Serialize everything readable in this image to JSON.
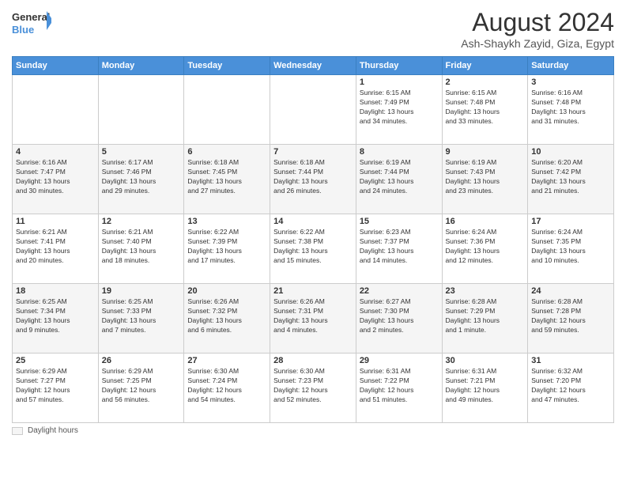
{
  "header": {
    "logo_line1": "General",
    "logo_line2": "Blue",
    "month_title": "August 2024",
    "location": "Ash-Shaykh Zayid, Giza, Egypt"
  },
  "days_of_week": [
    "Sunday",
    "Monday",
    "Tuesday",
    "Wednesday",
    "Thursday",
    "Friday",
    "Saturday"
  ],
  "legend_label": "Daylight hours",
  "weeks": [
    [
      {
        "day": "",
        "info": ""
      },
      {
        "day": "",
        "info": ""
      },
      {
        "day": "",
        "info": ""
      },
      {
        "day": "",
        "info": ""
      },
      {
        "day": "1",
        "info": "Sunrise: 6:15 AM\nSunset: 7:49 PM\nDaylight: 13 hours\nand 34 minutes."
      },
      {
        "day": "2",
        "info": "Sunrise: 6:15 AM\nSunset: 7:48 PM\nDaylight: 13 hours\nand 33 minutes."
      },
      {
        "day": "3",
        "info": "Sunrise: 6:16 AM\nSunset: 7:48 PM\nDaylight: 13 hours\nand 31 minutes."
      }
    ],
    [
      {
        "day": "4",
        "info": "Sunrise: 6:16 AM\nSunset: 7:47 PM\nDaylight: 13 hours\nand 30 minutes."
      },
      {
        "day": "5",
        "info": "Sunrise: 6:17 AM\nSunset: 7:46 PM\nDaylight: 13 hours\nand 29 minutes."
      },
      {
        "day": "6",
        "info": "Sunrise: 6:18 AM\nSunset: 7:45 PM\nDaylight: 13 hours\nand 27 minutes."
      },
      {
        "day": "7",
        "info": "Sunrise: 6:18 AM\nSunset: 7:44 PM\nDaylight: 13 hours\nand 26 minutes."
      },
      {
        "day": "8",
        "info": "Sunrise: 6:19 AM\nSunset: 7:44 PM\nDaylight: 13 hours\nand 24 minutes."
      },
      {
        "day": "9",
        "info": "Sunrise: 6:19 AM\nSunset: 7:43 PM\nDaylight: 13 hours\nand 23 minutes."
      },
      {
        "day": "10",
        "info": "Sunrise: 6:20 AM\nSunset: 7:42 PM\nDaylight: 13 hours\nand 21 minutes."
      }
    ],
    [
      {
        "day": "11",
        "info": "Sunrise: 6:21 AM\nSunset: 7:41 PM\nDaylight: 13 hours\nand 20 minutes."
      },
      {
        "day": "12",
        "info": "Sunrise: 6:21 AM\nSunset: 7:40 PM\nDaylight: 13 hours\nand 18 minutes."
      },
      {
        "day": "13",
        "info": "Sunrise: 6:22 AM\nSunset: 7:39 PM\nDaylight: 13 hours\nand 17 minutes."
      },
      {
        "day": "14",
        "info": "Sunrise: 6:22 AM\nSunset: 7:38 PM\nDaylight: 13 hours\nand 15 minutes."
      },
      {
        "day": "15",
        "info": "Sunrise: 6:23 AM\nSunset: 7:37 PM\nDaylight: 13 hours\nand 14 minutes."
      },
      {
        "day": "16",
        "info": "Sunrise: 6:24 AM\nSunset: 7:36 PM\nDaylight: 13 hours\nand 12 minutes."
      },
      {
        "day": "17",
        "info": "Sunrise: 6:24 AM\nSunset: 7:35 PM\nDaylight: 13 hours\nand 10 minutes."
      }
    ],
    [
      {
        "day": "18",
        "info": "Sunrise: 6:25 AM\nSunset: 7:34 PM\nDaylight: 13 hours\nand 9 minutes."
      },
      {
        "day": "19",
        "info": "Sunrise: 6:25 AM\nSunset: 7:33 PM\nDaylight: 13 hours\nand 7 minutes."
      },
      {
        "day": "20",
        "info": "Sunrise: 6:26 AM\nSunset: 7:32 PM\nDaylight: 13 hours\nand 6 minutes."
      },
      {
        "day": "21",
        "info": "Sunrise: 6:26 AM\nSunset: 7:31 PM\nDaylight: 13 hours\nand 4 minutes."
      },
      {
        "day": "22",
        "info": "Sunrise: 6:27 AM\nSunset: 7:30 PM\nDaylight: 13 hours\nand 2 minutes."
      },
      {
        "day": "23",
        "info": "Sunrise: 6:28 AM\nSunset: 7:29 PM\nDaylight: 13 hours\nand 1 minute."
      },
      {
        "day": "24",
        "info": "Sunrise: 6:28 AM\nSunset: 7:28 PM\nDaylight: 12 hours\nand 59 minutes."
      }
    ],
    [
      {
        "day": "25",
        "info": "Sunrise: 6:29 AM\nSunset: 7:27 PM\nDaylight: 12 hours\nand 57 minutes."
      },
      {
        "day": "26",
        "info": "Sunrise: 6:29 AM\nSunset: 7:25 PM\nDaylight: 12 hours\nand 56 minutes."
      },
      {
        "day": "27",
        "info": "Sunrise: 6:30 AM\nSunset: 7:24 PM\nDaylight: 12 hours\nand 54 minutes."
      },
      {
        "day": "28",
        "info": "Sunrise: 6:30 AM\nSunset: 7:23 PM\nDaylight: 12 hours\nand 52 minutes."
      },
      {
        "day": "29",
        "info": "Sunrise: 6:31 AM\nSunset: 7:22 PM\nDaylight: 12 hours\nand 51 minutes."
      },
      {
        "day": "30",
        "info": "Sunrise: 6:31 AM\nSunset: 7:21 PM\nDaylight: 12 hours\nand 49 minutes."
      },
      {
        "day": "31",
        "info": "Sunrise: 6:32 AM\nSunset: 7:20 PM\nDaylight: 12 hours\nand 47 minutes."
      }
    ]
  ]
}
